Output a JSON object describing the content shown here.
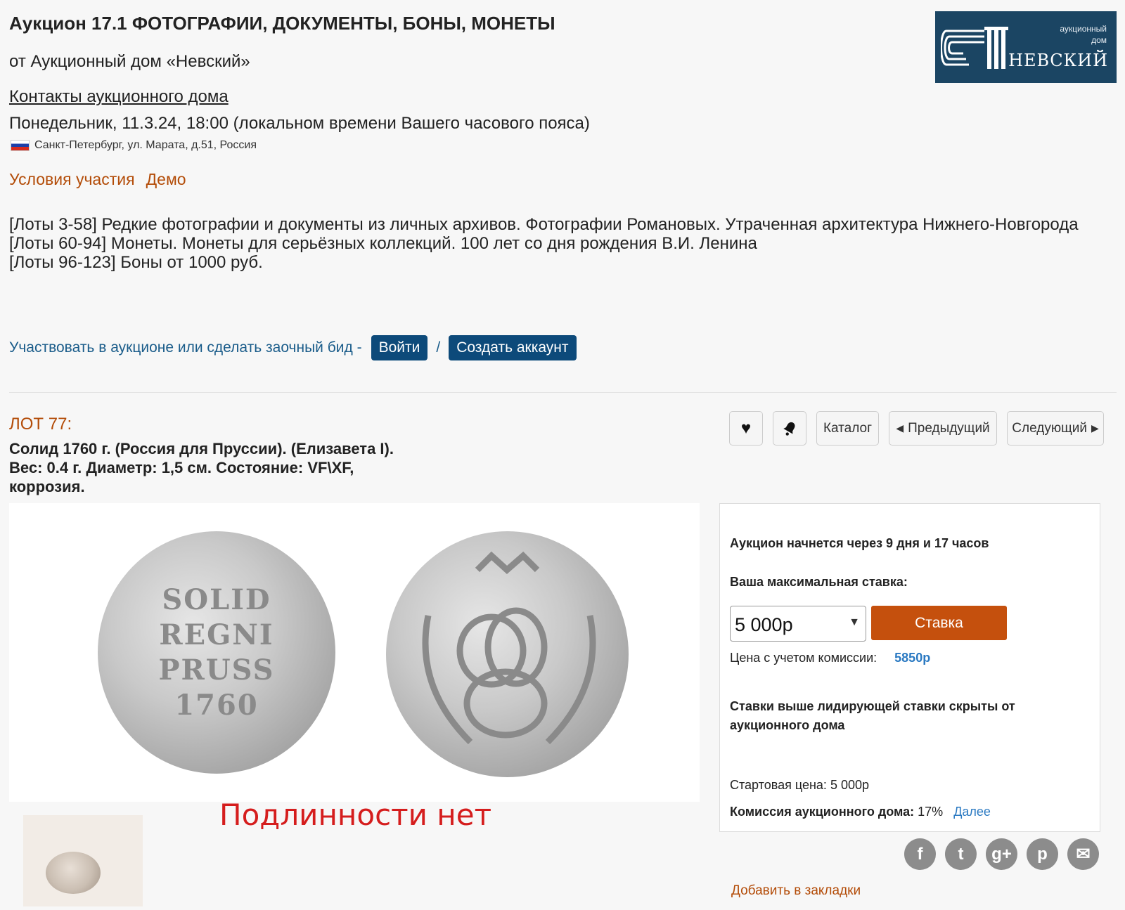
{
  "header": {
    "title": "Аукцион 17.1 ФОТОГРАФИИ, ДОКУМЕНТЫ, БОНЫ, МОНЕТЫ",
    "from": "от Аукционный дом «Невский»",
    "contacts": "Контакты аукционного дома",
    "date": "Понедельник, 11.3.24, 18:00 (локальном времени Вашего часового пояса)",
    "address": "Санкт-Петербург, ул. Марата, д.51, Россия",
    "conditions": "Условия участия",
    "demo": "Демо"
  },
  "logo": {
    "line1": "аукционный",
    "line2": "дом",
    "name": "НЕВСКИЙ"
  },
  "description": {
    "line1": "[Лоты 3-58] Редкие фотографии и документы из личных архивов. Фотографии Романовых. Утраченная архитектура Нижнего-Новгорода",
    "line2": "[Лоты 60-94] Монеты. Монеты для серьёзных коллекций. 100 лет со дня рождения В.И. Ленина",
    "line3": "[Лоты 96-123] Боны от 1000 руб."
  },
  "participate": {
    "text": "Участвовать в аукционе или сделать заочный бид -",
    "login": "Войти",
    "separator": "/",
    "register": "Создать аккаунт"
  },
  "lot": {
    "label": "ЛОТ 77:",
    "title": "Солид 1760 г. (Россия для Пруссии). (Елизавета I). Вес: 0.4 г. Диаметр: 1,5 см. Состояние: VF\\XF, коррозия.",
    "coin_obverse": [
      "SOLID",
      "REGNI",
      "PRUSS",
      "1760"
    ],
    "watermark": "Подлинности нет"
  },
  "toolbar": {
    "catalog": "Каталог",
    "prev": "Предыдущий",
    "next": "Следующий"
  },
  "bid": {
    "starts_in": "Аукцион начнется через 9 дня и 17 часов",
    "max_bid_label": "Ваша максимальная ставка:",
    "selected_value": "5 000р",
    "button": "Ставка",
    "price_with_commission_label": "Цена с учетом комиссии:",
    "price_with_commission_value": "5850р",
    "hidden_note": "Ставки выше лидирующей ставки скрыты от аукционного дома",
    "start_price_label": "Стартовая цена:",
    "start_price_value": "5 000р",
    "commission_label": "Комиссия аукционного дома:",
    "commission_value": "17%",
    "more": "Далее"
  },
  "social": {
    "facebook": "f",
    "twitter": "t",
    "googleplus": "g+",
    "pinterest": "p",
    "email": "✉"
  },
  "bookmark": "Добавить в закладки",
  "colors": {
    "accent_orange": "#b34c08",
    "bid_button": "#c5500d",
    "primary_blue": "#0d4a7a",
    "link_blue": "#2a79c2",
    "logo_bg": "#1b4563",
    "watermark_red": "#d51d1d"
  }
}
